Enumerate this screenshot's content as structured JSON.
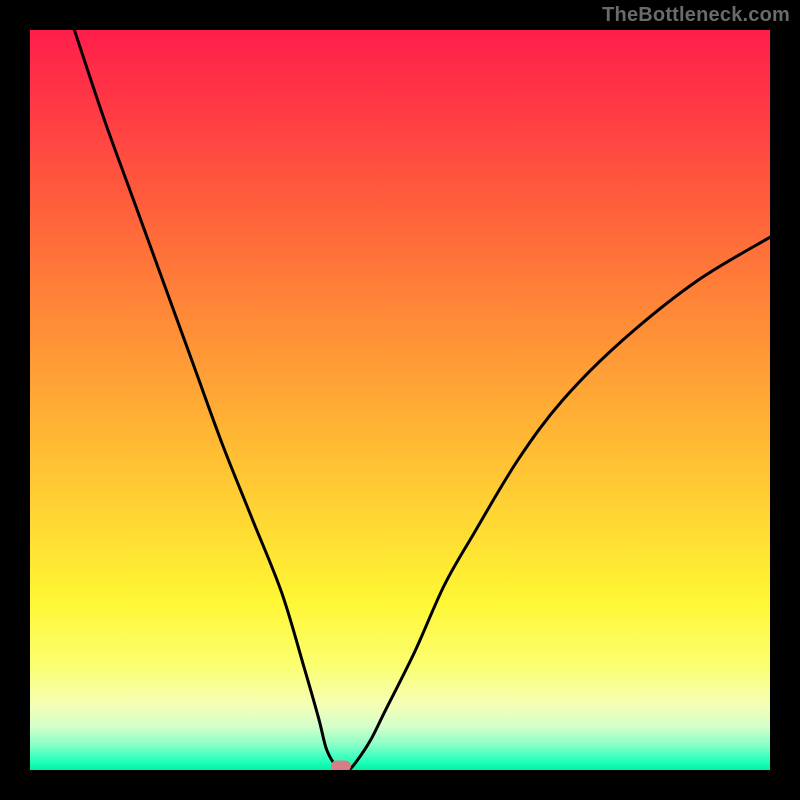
{
  "watermark": "TheBottleneck.com",
  "colors": {
    "frame_bg": "#000000",
    "marker": "#d57f85",
    "curve": "#000000",
    "watermark": "#6a6a6a"
  },
  "chart_data": {
    "type": "line",
    "title": "",
    "xlabel": "",
    "ylabel": "",
    "xlim": [
      0,
      100
    ],
    "ylim": [
      0,
      100
    ],
    "grid": false,
    "legend": false,
    "bottleneck_x": 42,
    "series": [
      {
        "name": "bottleneck-curve",
        "x": [
          6,
          10,
          14,
          18,
          22,
          26,
          30,
          34,
          37,
          39,
          40,
          41,
          42,
          43,
          44,
          46,
          48,
          52,
          56,
          60,
          66,
          72,
          80,
          90,
          100
        ],
        "y": [
          100,
          88,
          77,
          66,
          55,
          44,
          34,
          24,
          14,
          7,
          3,
          1,
          0,
          0,
          1,
          4,
          8,
          16,
          25,
          32,
          42,
          50,
          58,
          66,
          72
        ]
      }
    ],
    "background_gradient_stops": [
      {
        "pos": 0,
        "color": "#ff1e4b"
      },
      {
        "pos": 0.5,
        "color": "#ffa935"
      },
      {
        "pos": 0.77,
        "color": "#fff633"
      },
      {
        "pos": 0.94,
        "color": "#d6ffca"
      },
      {
        "pos": 1.0,
        "color": "#00f0a8"
      }
    ],
    "marker": {
      "x": 42,
      "y": 0,
      "shape": "rounded-rect",
      "color": "#d57f85"
    }
  }
}
